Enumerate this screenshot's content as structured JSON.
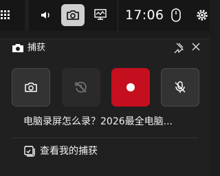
{
  "topbar": {
    "icons": [
      "grid-icon",
      "speaker-icon",
      "camera-icon",
      "performance-icon",
      "mouse-icon",
      "gear-icon"
    ],
    "clock": "17:06",
    "active_color": "#cfcfcf"
  },
  "capture_panel": {
    "title": "捕获",
    "header_icons": [
      "camera-icon",
      "pin-icon",
      "close-icon"
    ],
    "buttons": [
      {
        "name": "screenshot",
        "icon": "camera-icon"
      },
      {
        "name": "record-last-30s",
        "icon": "history-icon",
        "enabled": false
      },
      {
        "name": "start-recording",
        "icon": "record-dot-icon",
        "color": "#c50f1f"
      },
      {
        "name": "microphone",
        "icon": "mic-off-icon",
        "state": "off"
      }
    ],
    "capture_title": "电脑录屏怎么录？2026最全电脑...",
    "gallery_link": "查看我的捕获"
  },
  "colors": {
    "background": "#202020",
    "topbar": "#161616",
    "record": "#c50f1f"
  }
}
